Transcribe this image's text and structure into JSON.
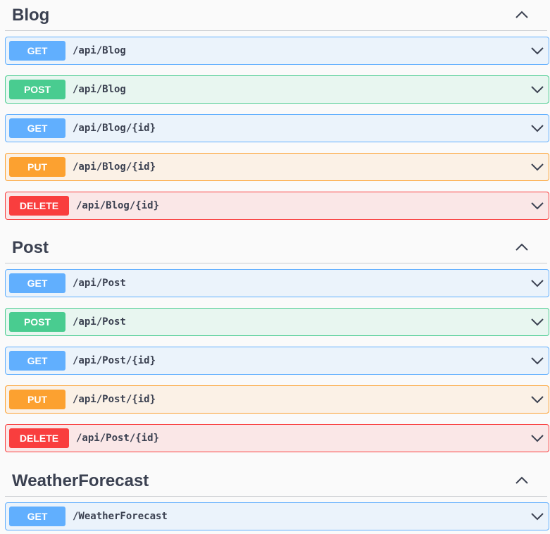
{
  "sections": [
    {
      "title": "Blog",
      "operations": [
        {
          "method": "GET",
          "path": "/api/Blog"
        },
        {
          "method": "POST",
          "path": "/api/Blog"
        },
        {
          "method": "GET",
          "path": "/api/Blog/{id}"
        },
        {
          "method": "PUT",
          "path": "/api/Blog/{id}"
        },
        {
          "method": "DELETE",
          "path": "/api/Blog/{id}"
        }
      ]
    },
    {
      "title": "Post",
      "operations": [
        {
          "method": "GET",
          "path": "/api/Post"
        },
        {
          "method": "POST",
          "path": "/api/Post"
        },
        {
          "method": "GET",
          "path": "/api/Post/{id}"
        },
        {
          "method": "PUT",
          "path": "/api/Post/{id}"
        },
        {
          "method": "DELETE",
          "path": "/api/Post/{id}"
        }
      ]
    },
    {
      "title": "WeatherForecast",
      "operations": [
        {
          "method": "GET",
          "path": "/WeatherForecast"
        }
      ]
    }
  ],
  "icons": {
    "section_toggle": "chevron-up-icon",
    "operation_toggle": "chevron-down-icon"
  },
  "colors": {
    "get": "#61affe",
    "post": "#49cc90",
    "put": "#fca130",
    "delete": "#f93e3e",
    "text": "#3b4151"
  }
}
